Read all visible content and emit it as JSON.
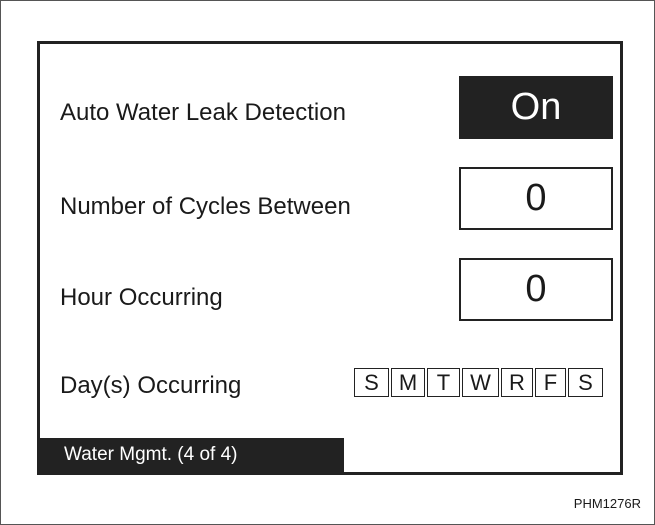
{
  "settings": [
    {
      "label": "Auto Water Leak Detection",
      "value": "On",
      "highlighted": true
    },
    {
      "label": "Number of Cycles Between",
      "value": "0",
      "highlighted": false
    },
    {
      "label": "Hour Occurring",
      "value": "0",
      "highlighted": false
    }
  ],
  "days": {
    "label": "Day(s) Occurring",
    "letters": [
      "S",
      "M",
      "T",
      "W",
      "R",
      "F",
      "S"
    ]
  },
  "page_tab": {
    "label": "Water Mgmt. (4 of 4)"
  },
  "figure_id": "PHM1276R",
  "colors": {
    "foreground": "#222222",
    "background": "#ffffff",
    "highlight_text": "#ffffff"
  }
}
